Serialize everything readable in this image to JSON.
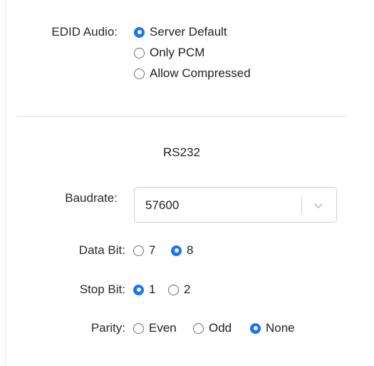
{
  "edid": {
    "label": "EDID Audio:",
    "options": [
      {
        "label": "Server Default",
        "checked": true
      },
      {
        "label": "Only PCM",
        "checked": false
      },
      {
        "label": "Allow Compressed",
        "checked": false
      }
    ]
  },
  "rs232": {
    "title": "RS232",
    "baudrate": {
      "label": "Baudrate:",
      "value": "57600"
    },
    "data_bit": {
      "label": "Data Bit:",
      "options": [
        {
          "label": "7",
          "checked": false
        },
        {
          "label": "8",
          "checked": true
        }
      ]
    },
    "stop_bit": {
      "label": "Stop Bit:",
      "options": [
        {
          "label": "1",
          "checked": true
        },
        {
          "label": "2",
          "checked": false
        }
      ]
    },
    "parity": {
      "label": "Parity:",
      "options": [
        {
          "label": "Even",
          "checked": false
        },
        {
          "label": "Odd",
          "checked": false
        },
        {
          "label": "None",
          "checked": true
        }
      ]
    }
  },
  "colors": {
    "accent": "#1a73f5",
    "divider": "#e0e0e0"
  }
}
